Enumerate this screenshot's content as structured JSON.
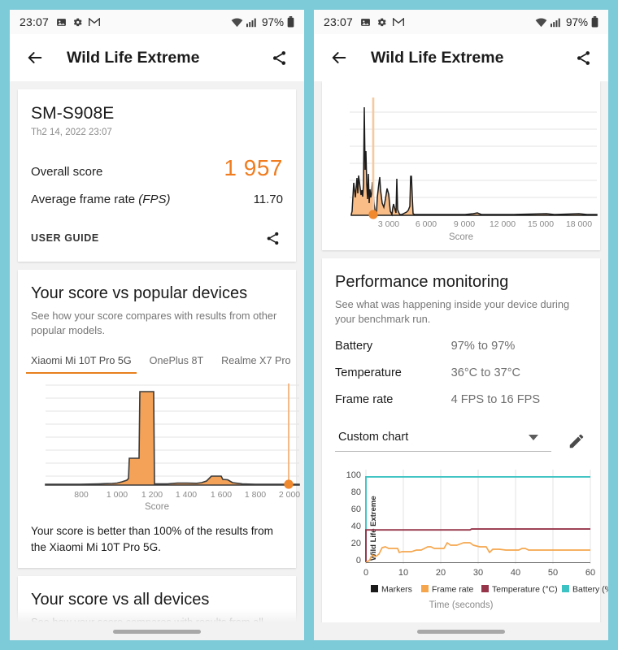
{
  "status_bar": {
    "time": "23:07",
    "battery_percent": "97%",
    "left_icons": [
      "image-icon",
      "gear-icon",
      "gmail-icon"
    ],
    "right_icons": [
      "wifi-icon",
      "signal-icon",
      "battery-icon"
    ]
  },
  "app_bar": {
    "title": "Wild Life Extreme",
    "back_icon": "arrow-left-icon",
    "share_icon": "share-icon"
  },
  "score_card": {
    "device_name": "SM-S908E",
    "date": "Th2 14, 2022 23:07",
    "overall_score_label": "Overall score",
    "overall_score_value": "1 957",
    "fps_label": "Average frame rate",
    "fps_label_italic": "(FPS)",
    "fps_value": "11.70",
    "user_guide_label": "USER GUIDE",
    "accent_color": "#f07c1f"
  },
  "popular_devices": {
    "title": "Your score vs popular devices",
    "subtitle": "See how your score compares with results from other popular models.",
    "tabs": [
      {
        "label": "Xiaomi Mi 10T Pro 5G",
        "active": true
      },
      {
        "label": "OnePlus 8T",
        "active": false
      },
      {
        "label": "Realme X7 Pro",
        "active": false
      }
    ],
    "note": "Your score is better than 100% of the results from the Xiaomi Mi 10T Pro 5G."
  },
  "all_devices": {
    "title": "Your score vs all devices",
    "subtitle": "See how your score compares with results from all other"
  },
  "performance_monitoring": {
    "title": "Performance monitoring",
    "subtitle": "See what was happening inside your device during your benchmark run.",
    "rows": [
      {
        "key": "Battery",
        "value": "97% to 97%"
      },
      {
        "key": "Temperature",
        "value": "36°C to 37°C"
      },
      {
        "key": "Frame rate",
        "value": "4 FPS to 16 FPS"
      }
    ],
    "chart_select_value": "Custom chart",
    "chart_select_caret": "chevron-down-icon",
    "edit_icon": "pencil-icon"
  },
  "chart_data": [
    {
      "id": "popular-devices-histogram",
      "type": "area",
      "title": "",
      "xlabel": "Score",
      "ylabel": "",
      "xlim": [
        700,
        2060
      ],
      "ylim": [
        0,
        100
      ],
      "xticks": [
        800,
        1000,
        1200,
        1400,
        1600,
        1800,
        2000
      ],
      "xticklabels": [
        "800",
        "1 000",
        "1 200",
        "1 400",
        "1 600",
        "1 800",
        "2 000"
      ],
      "grid": true,
      "gridlines": 9,
      "fill_color": "#f4a257",
      "line_color": "#3b3b3b",
      "marker": {
        "x": 1957,
        "y": 0,
        "color": "#f0882e",
        "label": "your score"
      },
      "x": [
        700,
        760,
        820,
        880,
        940,
        960,
        980,
        1000,
        1020,
        1040,
        1060,
        1080,
        1100,
        1110,
        1130,
        1160,
        1200,
        1240,
        1280,
        1320,
        1360,
        1400,
        1420,
        1440,
        1460,
        1480,
        1500,
        1520,
        1540,
        1580,
        1620,
        1700,
        1800,
        1900,
        2000,
        2060
      ],
      "y": [
        1,
        1,
        1,
        1,
        1,
        2,
        3,
        4,
        6,
        22,
        22,
        100,
        100,
        2,
        1,
        1,
        2,
        2,
        2,
        1,
        2,
        3,
        9,
        11,
        11,
        6,
        6,
        5,
        2,
        1,
        0,
        0,
        0,
        0,
        0,
        0
      ]
    },
    {
      "id": "all-devices-histogram",
      "type": "area",
      "title": "",
      "xlabel": "Score",
      "ylabel": "",
      "xlim": [
        0,
        20500
      ],
      "ylim": [
        0,
        100
      ],
      "xticks": [
        3000,
        6000,
        9000,
        12000,
        15000,
        18000
      ],
      "xticklabels": [
        "3 000",
        "6 000",
        "9 000",
        "12 000",
        "15 000",
        "18 000"
      ],
      "grid": true,
      "gridlines": 7,
      "fill_color": "#f8b680",
      "line_color": "#1c1c1c",
      "marker": {
        "x": 1957,
        "y": 0,
        "color": "#f0882e",
        "label": "your score"
      },
      "x": [
        100,
        250,
        400,
        550,
        700,
        800,
        900,
        1000,
        1100,
        1200,
        1300,
        1400,
        1500,
        1600,
        1700,
        1800,
        1900,
        2000,
        2150,
        2300,
        2450,
        2600,
        2750,
        2900,
        3100,
        3300,
        3500,
        3700,
        3900,
        4100,
        4300,
        4500,
        4700,
        4900,
        5000,
        5100,
        5200,
        5300,
        5500,
        6000,
        7000,
        8000,
        9000,
        9500,
        10000,
        11000,
        12000,
        13000,
        14000,
        15000,
        16000,
        17000,
        18000,
        19000,
        20500
      ],
      "y": [
        3,
        30,
        18,
        36,
        22,
        40,
        34,
        26,
        96,
        48,
        60,
        32,
        20,
        46,
        18,
        30,
        24,
        40,
        22,
        8,
        28,
        38,
        26,
        18,
        14,
        20,
        34,
        12,
        6,
        4,
        5,
        30,
        6,
        4,
        44,
        44,
        18,
        1,
        0,
        0,
        0,
        0,
        1,
        2,
        1,
        0,
        0,
        1,
        0,
        0,
        1,
        1,
        2,
        1,
        0
      ]
    },
    {
      "id": "custom-chart",
      "type": "line",
      "title": "Wild Life Extreme",
      "xlabel": "Time (seconds)",
      "ylabel": "Wild Life Extreme",
      "xlim": [
        0,
        62
      ],
      "ylim": [
        0,
        104
      ],
      "xticks": [
        0,
        10,
        20,
        30,
        40,
        50,
        60
      ],
      "xticklabels": [
        "0",
        "10",
        "20",
        "30",
        "40",
        "50",
        "60"
      ],
      "yticks": [
        0,
        20,
        40,
        60,
        80,
        100
      ],
      "yticklabels": [
        "0",
        "20",
        "40",
        "60",
        "80",
        "100"
      ],
      "grid": true,
      "legend_position": "bottom",
      "legend": [
        {
          "name": "Markers",
          "color": "#1a1a1a"
        },
        {
          "name": "Frame rate",
          "color": "#f5a64d"
        },
        {
          "name": "Temperature (°C)",
          "color": "#96354a"
        },
        {
          "name": "Battery (%)",
          "color": "#3cc2c2"
        }
      ],
      "series": [
        {
          "name": "Battery (%)",
          "color": "#3cc2c2",
          "x": [
            0,
            62
          ],
          "y": [
            97,
            97
          ]
        },
        {
          "name": "Temperature (°C)",
          "color": "#96354a",
          "x": [
            0,
            10,
            20,
            28,
            29,
            40,
            50,
            62
          ],
          "y": [
            36,
            36,
            36,
            36,
            37,
            37,
            37,
            37
          ]
        },
        {
          "name": "Frame rate",
          "color": "#f5a64d",
          "x": [
            0,
            1,
            2,
            3,
            4,
            5,
            6,
            8,
            10,
            12,
            12.5,
            13,
            14,
            16,
            18,
            20,
            22,
            23,
            24,
            25,
            26,
            28,
            29,
            30,
            31,
            33,
            35,
            36,
            37,
            38,
            40,
            42,
            44,
            45,
            46,
            48,
            50,
            52,
            54,
            55,
            56,
            57,
            58,
            60,
            62
          ],
          "y": [
            0,
            2,
            5,
            4,
            6,
            15,
            14,
            13,
            13,
            13,
            13,
            9,
            10,
            10,
            10,
            11,
            11,
            12,
            13,
            13,
            12,
            12,
            12,
            15,
            14,
            14,
            15,
            15,
            15,
            14,
            13,
            12,
            12,
            9,
            11,
            11,
            10,
            10,
            10,
            11,
            11,
            10,
            9,
            9,
            9
          ]
        }
      ]
    }
  ]
}
